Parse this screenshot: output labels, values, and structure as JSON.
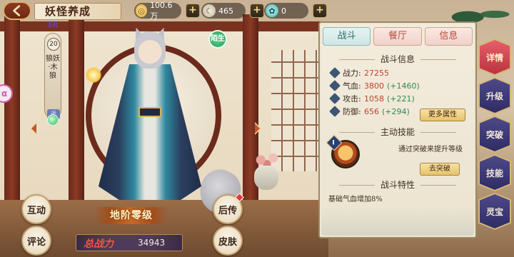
{
  "header": {
    "title": "妖怪养成",
    "resources": [
      {
        "icon": "gold-coin-icon",
        "value": "100.6万"
      },
      {
        "icon": "spirit-jade-icon",
        "value": "465"
      },
      {
        "icon": "dewdrop-icon",
        "value": "0"
      }
    ]
  },
  "character": {
    "rank": "SR",
    "level": "20",
    "name": "狼妖·木狼",
    "tag": "近",
    "sub_badge": "陌生",
    "grade": "地阶零级",
    "power_label": "总战力",
    "power": "34943"
  },
  "left_buttons": {
    "interact": "互动",
    "comment": "评论",
    "legend": "后传",
    "skin": "皮肤",
    "pink_tag": "α"
  },
  "panel": {
    "tabs": [
      "战斗",
      "餐厅",
      "信息"
    ],
    "active_tab": 0,
    "battle_info_title": "战斗信息",
    "stats": [
      {
        "label": "战力:",
        "value": "27255",
        "bonus": ""
      },
      {
        "label": "气血:",
        "value": "3800",
        "bonus": "(+1460)"
      },
      {
        "label": "攻击:",
        "value": "1058",
        "bonus": "(+221)"
      },
      {
        "label": "防御:",
        "value": "656",
        "bonus": "(+294)"
      }
    ],
    "more_attrs": "更多属性",
    "active_skill_title": "主动技能",
    "skill_level": "I",
    "skill_desc": "通过突破来提升等级",
    "break_btn": "去突破",
    "trait_title": "战斗特性",
    "trait_text": "基础气血增加8%"
  },
  "side_tabs": [
    "详情",
    "升级",
    "突破",
    "技能",
    "灵宝"
  ],
  "side_active": 0,
  "colors": {
    "accent_red": "#c1432e",
    "bonus_green": "#2f8a4e",
    "tab_active": "#b9343f",
    "tab_normal": "#2f2b62"
  }
}
